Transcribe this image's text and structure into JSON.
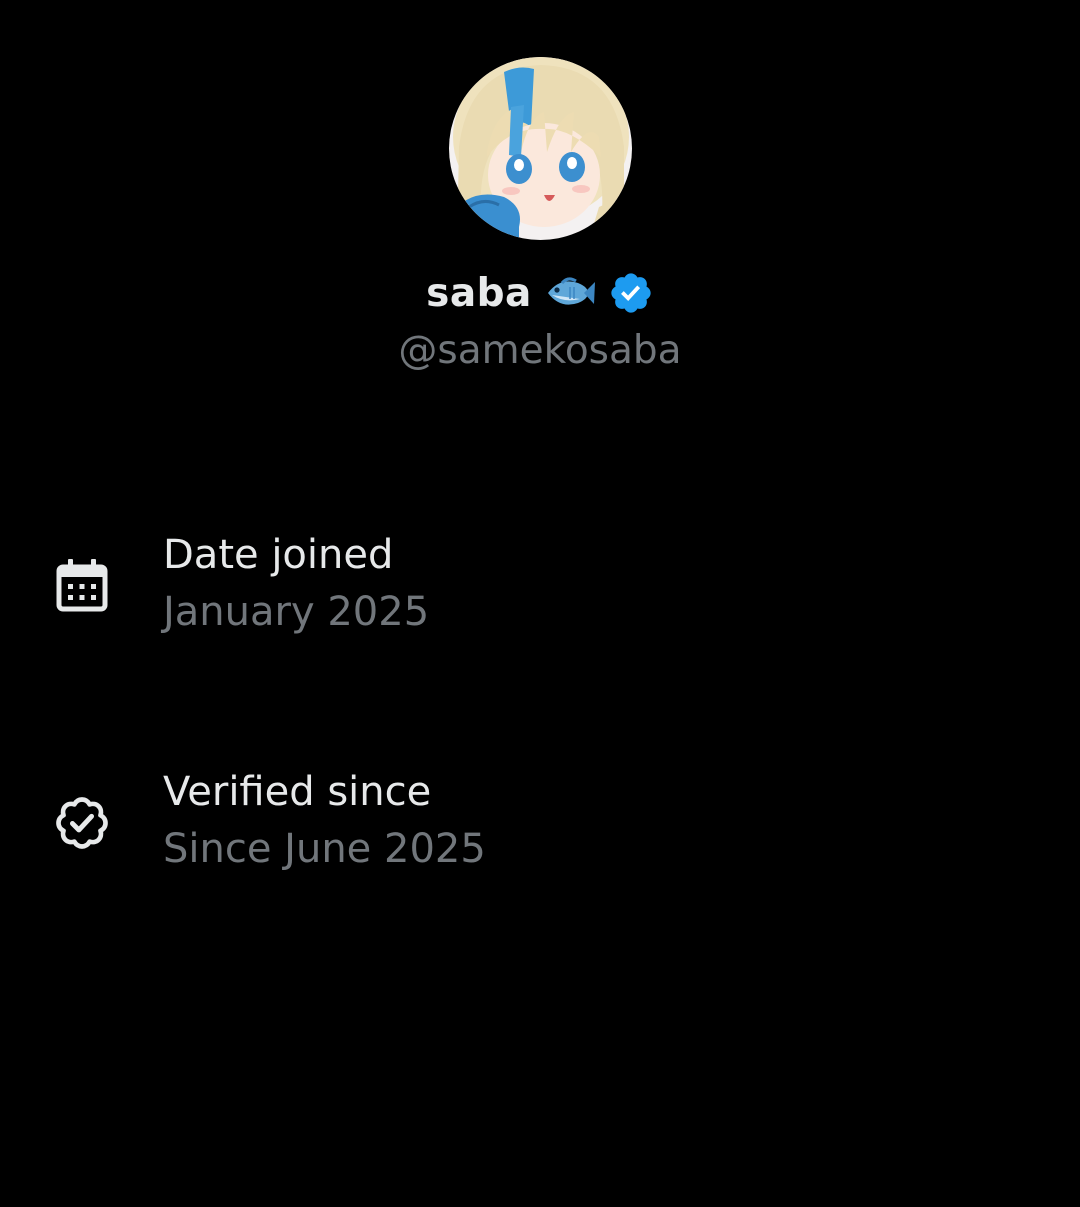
{
  "profile": {
    "display_name": "saba",
    "handle": "@samekosaba",
    "name_emoji_icon": "fish-icon",
    "badge_icon": "verified-badge-icon",
    "badge_color": "#1d9bf0"
  },
  "about": {
    "date_joined": {
      "icon": "calendar-icon",
      "title": "Date joined",
      "value": "January 2025"
    },
    "verified_since": {
      "icon": "verified-outline-icon",
      "title": "Verified since",
      "value": "Since June 2025"
    }
  },
  "colors": {
    "background": "#000000",
    "primary_text": "#e7e9ea",
    "secondary_text": "#71767b",
    "accent": "#1d9bf0"
  }
}
